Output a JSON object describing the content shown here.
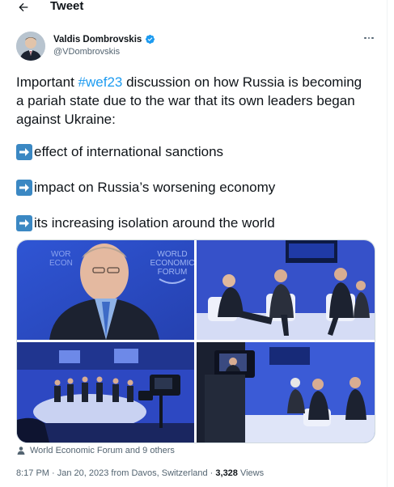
{
  "header": {
    "title": "Tweet"
  },
  "author": {
    "name": "Valdis Dombrovskis",
    "handle": "@VDombrovskis"
  },
  "tweet": {
    "text_before": "Important ",
    "hashtag": "#wef23",
    "text_after": " discussion on how Russia is becoming a pariah state due to the war that its own leaders began against Ukraine:",
    "bullets": [
      "effect of international sanctions",
      "impact on Russia’s worsening economy",
      "its increasing isolation around the world"
    ]
  },
  "media": {
    "photo1_logo": [
      "WORLD",
      "ECONOMIC",
      "FORUM"
    ],
    "photo1_logo_left": [
      "WOR",
      "ECON"
    ]
  },
  "tagged": "World Economic Forum and 9 others",
  "meta": {
    "time_date": "8:17 PM · Jan 20, 2023 from Davos, Switzerland · ",
    "views_count": "3,328",
    "views_label": " Views"
  },
  "colors": {
    "accent": "#1d9bf0",
    "stage_blue": "#3b5bd6",
    "arrow_emoji": "#3b88c3"
  }
}
